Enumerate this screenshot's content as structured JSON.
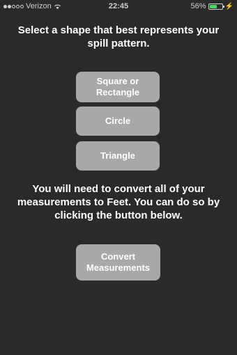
{
  "status_bar": {
    "carrier": "Verizon",
    "time": "22:45",
    "battery_percent": "56%",
    "battery_level": 0.56,
    "battery_color": "#4cd964"
  },
  "main": {
    "heading": "Select a shape that best represents your spill pattern.",
    "shape_buttons": [
      {
        "label_line1": "Square or",
        "label_line2": "Rectangle"
      },
      {
        "label": "Circle"
      },
      {
        "label": "Triangle"
      }
    ],
    "convert_text": "You will need to convert all of your measurements to Feet.  You can do so by clicking the button below.",
    "convert_button": {
      "label_line1": "Convert",
      "label_line2": "Measurements"
    }
  },
  "colors": {
    "background": "#2a2a2a",
    "button": "#a8a8a8",
    "text": "#ffffff"
  }
}
